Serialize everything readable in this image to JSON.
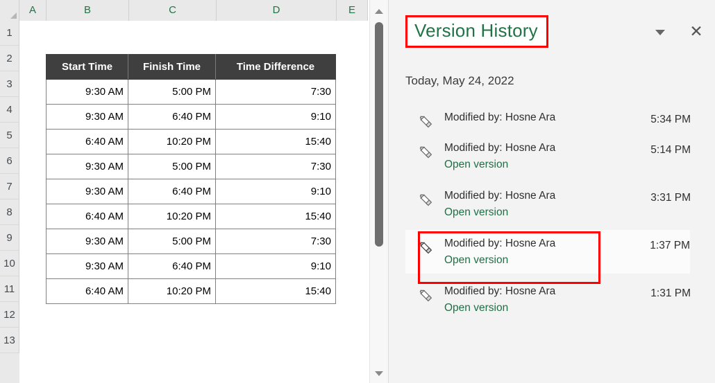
{
  "spreadsheet": {
    "column_headers": [
      "A",
      "B",
      "C",
      "D",
      "E"
    ],
    "row_headers": [
      "1",
      "2",
      "3",
      "4",
      "5",
      "6",
      "7",
      "8",
      "9",
      "10",
      "11",
      "12",
      "13"
    ],
    "table": {
      "headers": [
        "Start Time",
        "Finish Time",
        "Time Difference"
      ],
      "header_bg": "#3f3f3f",
      "header_color": "#ffffff",
      "rows": [
        [
          "9:30 AM",
          "5:00 PM",
          "7:30"
        ],
        [
          "9:30 AM",
          "6:40 PM",
          "9:10"
        ],
        [
          "6:40 AM",
          "10:20 PM",
          "15:40"
        ],
        [
          "9:30 AM",
          "5:00 PM",
          "7:30"
        ],
        [
          "9:30 AM",
          "6:40 PM",
          "9:10"
        ],
        [
          "6:40 AM",
          "10:20 PM",
          "15:40"
        ],
        [
          "9:30 AM",
          "5:00 PM",
          "7:30"
        ],
        [
          "9:30 AM",
          "6:40 PM",
          "9:10"
        ],
        [
          "6:40 AM",
          "10:20 PM",
          "15:40"
        ]
      ]
    },
    "scrollbar": {
      "up_arrow_icon": "triangle-up-icon",
      "down_arrow_icon": "triangle-down-icon",
      "thumb_icon": "scrollbar-thumb"
    }
  },
  "panel": {
    "title": "Version History",
    "title_color": "#217346",
    "collapse_icon": "chevron-down-icon",
    "close_icon": "close-icon",
    "close_glyph": "✕",
    "date_group_label": "Today, May 24, 2022",
    "link_color": "#1d7044",
    "highlight_color": "#ff0000",
    "versions": [
      {
        "pencil_icon": "pencil-icon",
        "modified_by": "Modified by: Hosne Ara",
        "time": "5:34 PM",
        "open_label": "",
        "selected": false
      },
      {
        "pencil_icon": "pencil-icon",
        "modified_by": "Modified by: Hosne Ara",
        "time": "5:14 PM",
        "open_label": "Open version",
        "selected": false
      },
      {
        "pencil_icon": "pencil-icon",
        "modified_by": "Modified by: Hosne Ara",
        "time": "3:31 PM",
        "open_label": "Open version",
        "selected": false
      },
      {
        "pencil_icon": "pencil-icon",
        "modified_by": "Modified by: Hosne Ara",
        "time": "1:37 PM",
        "open_label": "Open version",
        "selected": true
      },
      {
        "pencil_icon": "pencil-icon",
        "modified_by": "Modified by: Hosne Ara",
        "time": "1:31 PM",
        "open_label": "Open version",
        "selected": false
      }
    ]
  }
}
